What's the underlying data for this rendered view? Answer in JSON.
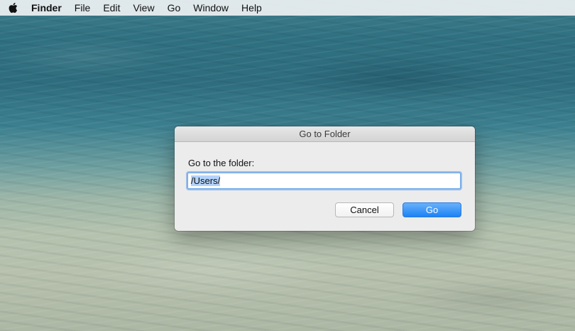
{
  "menubar": {
    "apple_icon": "apple-logo-icon",
    "app_name": "Finder",
    "items": [
      "File",
      "Edit",
      "View",
      "Go",
      "Window",
      "Help"
    ]
  },
  "dialog": {
    "title": "Go to Folder",
    "prompt": "Go to the folder:",
    "path_value": "/Users/",
    "cancel_label": "Cancel",
    "go_label": "Go"
  },
  "colors": {
    "accent": "#1c82f5",
    "focus_ring": "#6aa6ea",
    "dialog_bg": "#ececec"
  }
}
